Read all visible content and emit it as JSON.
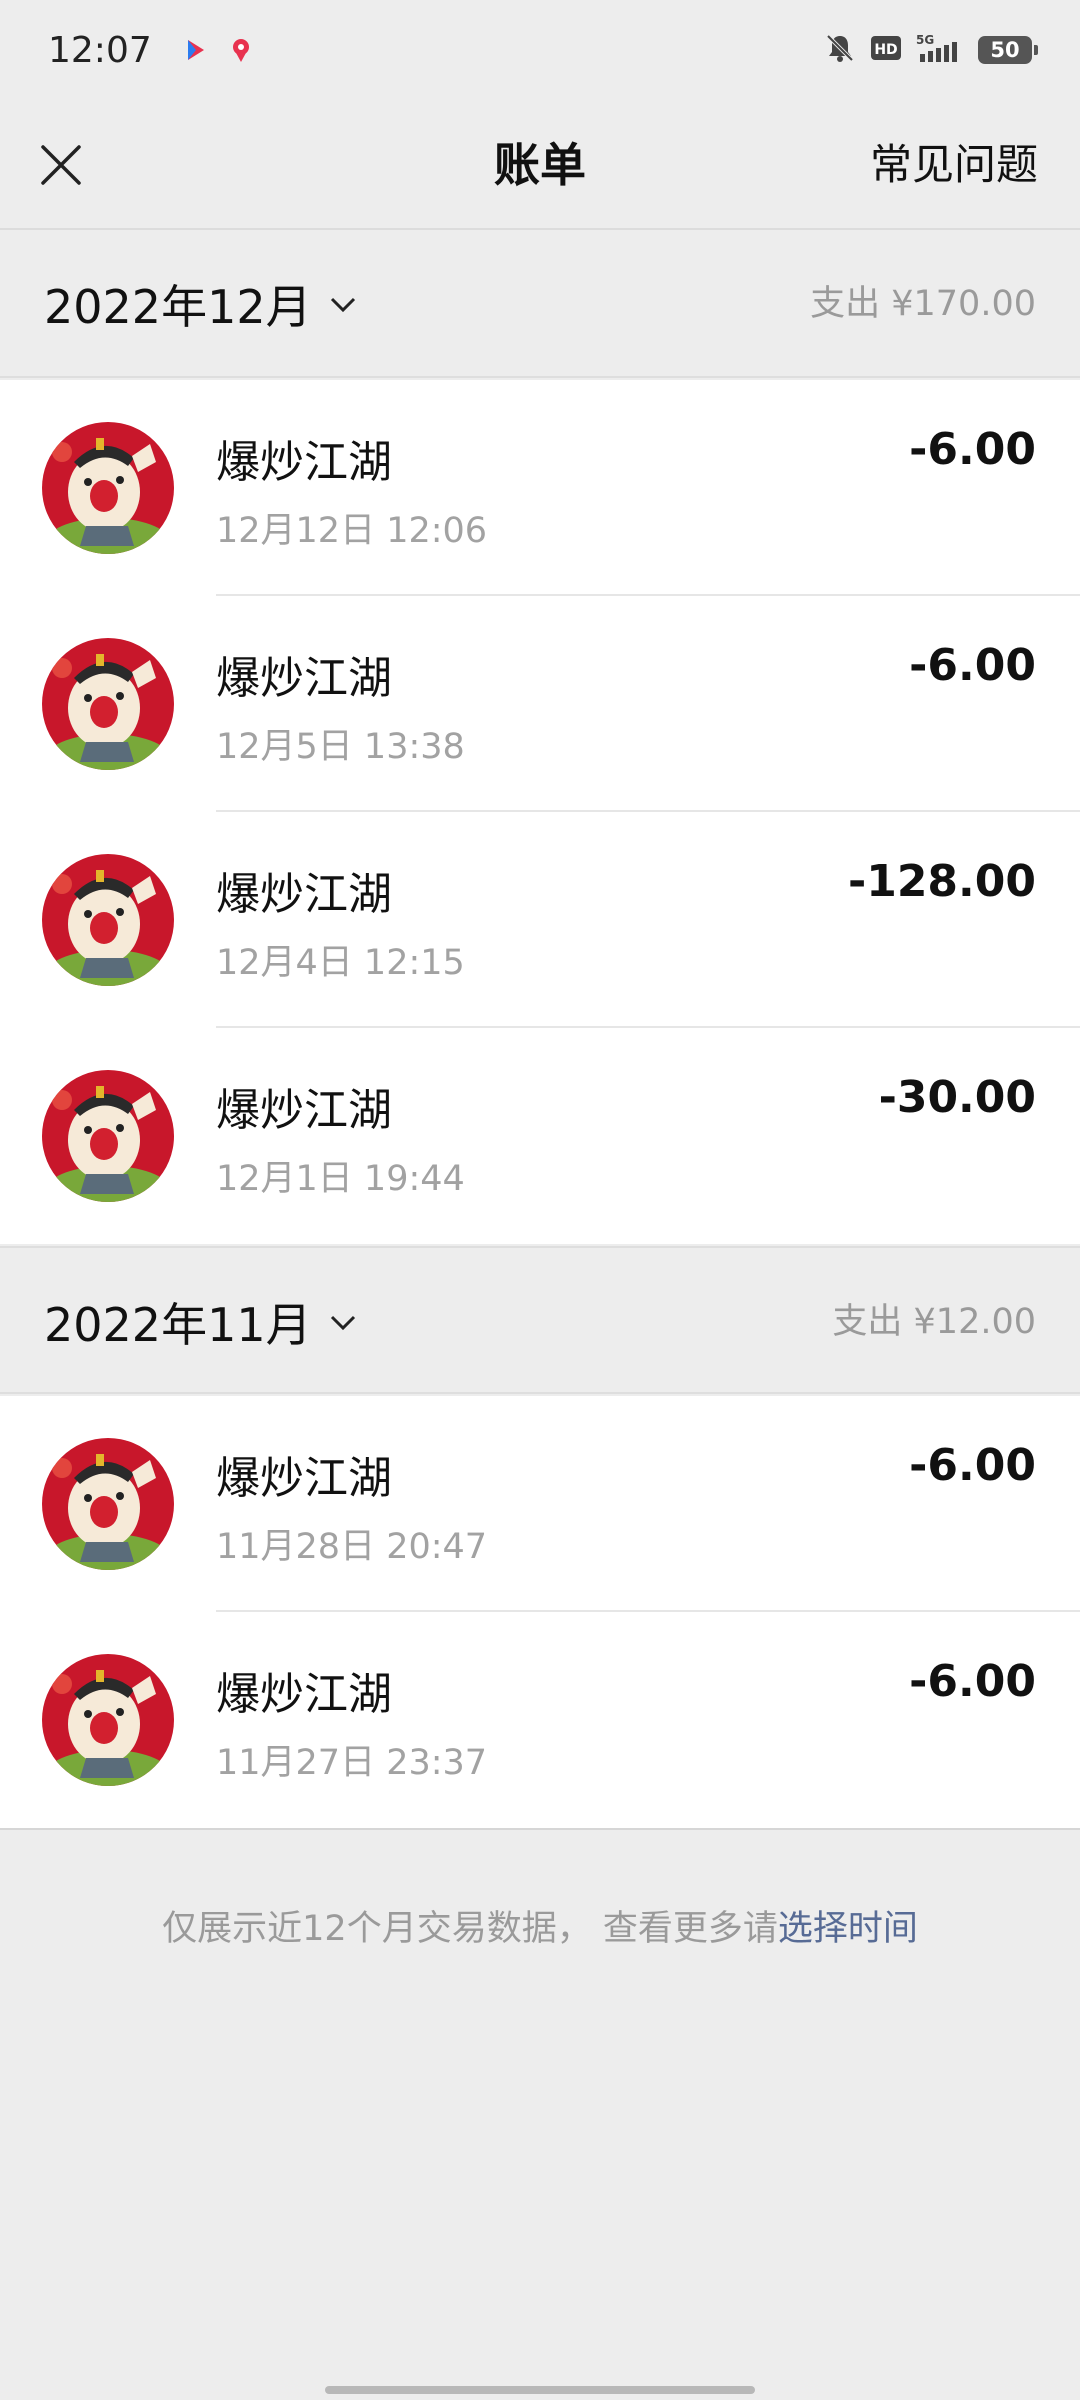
{
  "status_bar": {
    "time": "12:07",
    "battery": "50"
  },
  "nav": {
    "title": "账单",
    "faq_label": "常见问题"
  },
  "months": [
    {
      "label": "2022年12月",
      "total": "支出 ¥170.00",
      "items": [
        {
          "title": "爆炒江湖",
          "time": "12月12日 12:06",
          "amount": "-6.00"
        },
        {
          "title": "爆炒江湖",
          "time": "12月5日 13:38",
          "amount": "-6.00"
        },
        {
          "title": "爆炒江湖",
          "time": "12月4日 12:15",
          "amount": "-128.00"
        },
        {
          "title": "爆炒江湖",
          "time": "12月1日 19:44",
          "amount": "-30.00"
        }
      ]
    },
    {
      "label": "2022年11月",
      "total": "支出 ¥12.00",
      "items": [
        {
          "title": "爆炒江湖",
          "time": "11月28日 20:47",
          "amount": "-6.00"
        },
        {
          "title": "爆炒江湖",
          "time": "11月27日 23:37",
          "amount": "-6.00"
        }
      ]
    }
  ],
  "footer": {
    "note": "仅展示近12个月交易数据， 查看更多请",
    "link": "选择时间"
  },
  "colors": {
    "link": "#576b95",
    "background": "#ededed"
  }
}
